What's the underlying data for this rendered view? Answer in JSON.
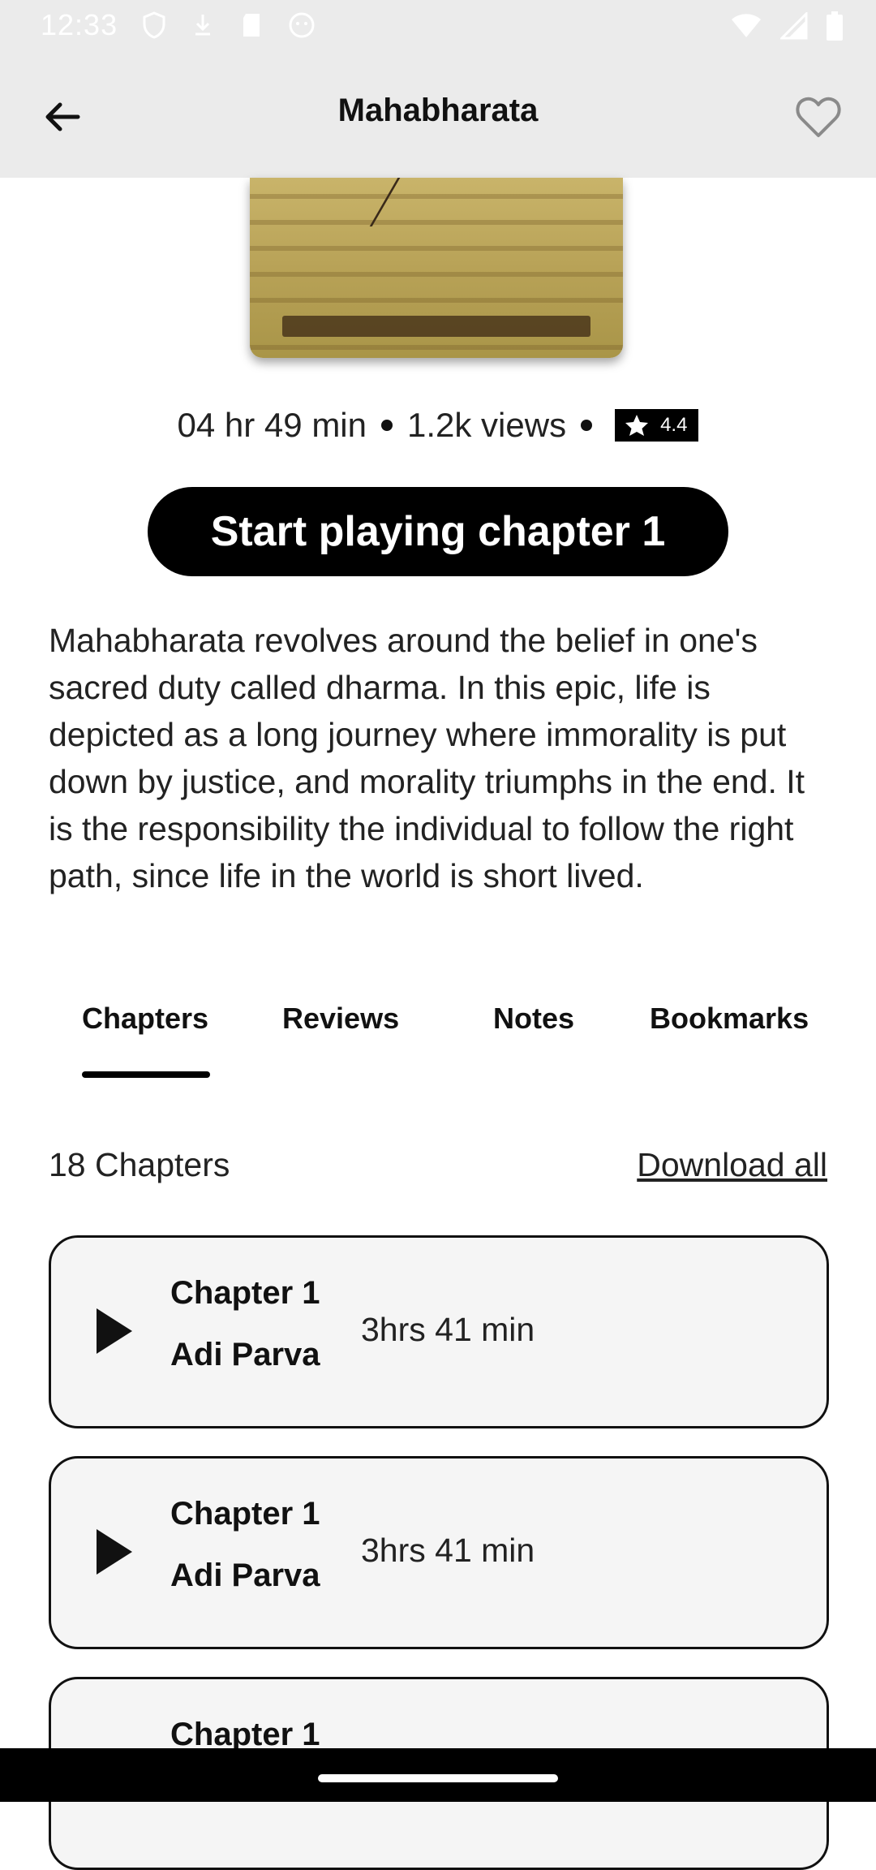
{
  "status_bar": {
    "time": "12:33"
  },
  "app_bar": {
    "title": "Mahabharata"
  },
  "meta": {
    "duration": "04 hr 49 min",
    "views": "1.2k views",
    "rating": "4.4"
  },
  "play_button": {
    "label": "Start playing chapter 1"
  },
  "description": "Mahabharata revolves around the belief in one's sacred duty called dharma.  In this epic, life is depicted as a long journey where immorality is put down by justice, and morality triumphs in the end. It is the  responsibility  the individual to follow the right path, since life in  the world is short lived.",
  "tabs": [
    {
      "label": "Chapters",
      "active": true
    },
    {
      "label": "Reviews",
      "active": false
    },
    {
      "label": "Notes",
      "active": false
    },
    {
      "label": "Bookmarks",
      "active": false
    }
  ],
  "list": {
    "count_label": "18 Chapters",
    "download_label": "Download all"
  },
  "chapters": [
    {
      "title": "Chapter 1",
      "subtitle": "Adi Parva",
      "duration": "3hrs 41 min"
    },
    {
      "title": "Chapter 1",
      "subtitle": "Adi Parva",
      "duration": "3hrs 41 min"
    },
    {
      "title": "Chapter 1",
      "subtitle": "",
      "duration": ""
    }
  ],
  "colors": {
    "appbar_bg": "#ebebeb",
    "primary": "#000000",
    "card_bg": "#f5f5f5"
  }
}
